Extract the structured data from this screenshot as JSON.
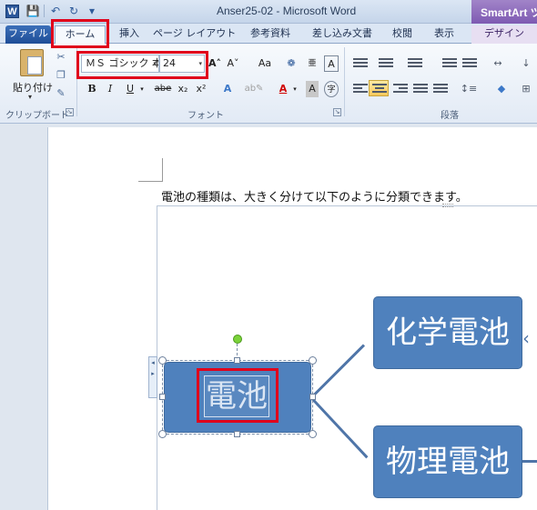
{
  "window": {
    "title": "Anser25-02 - Microsoft Word",
    "app_icon_letter": "W",
    "context_tab_title": "SmartArt ツ",
    "accent_color": "#2b579a",
    "context_color": "#7e5ab2"
  },
  "qat": {
    "icons": [
      "save-icon",
      "undo-icon",
      "redo-icon",
      "customize-icon"
    ]
  },
  "tabs": [
    {
      "label": "ファイル"
    },
    {
      "label": "ホーム"
    },
    {
      "label": "挿入"
    },
    {
      "label": "ページ レイアウト"
    },
    {
      "label": "参考資料"
    },
    {
      "label": "差し込み文書"
    },
    {
      "label": "校閲"
    },
    {
      "label": "表示"
    },
    {
      "label": "デザイン"
    }
  ],
  "ribbon": {
    "clipboard": {
      "paste_label": "貼り付け",
      "group_label": "クリップボード"
    },
    "font": {
      "name": "ＭＳ ゴシック 本",
      "size": "24",
      "grow": "A˄",
      "shrink": "A˅",
      "case": "Aa",
      "bold": "B",
      "italic": "I",
      "underline": "U",
      "strike": "abe",
      "subscript": "x₂",
      "superscript": "x²",
      "font_color": "A",
      "group_label": "フォント"
    },
    "paragraph": {
      "group_label": "段落"
    }
  },
  "document": {
    "body_text": "電池の種類は、大きく分けて以下のように分類できます。",
    "smartart": {
      "root": "電池",
      "children": [
        "化学電池",
        "物理電池"
      ],
      "node_color": "#4f81bd"
    }
  },
  "highlights_color": "#e0001b"
}
